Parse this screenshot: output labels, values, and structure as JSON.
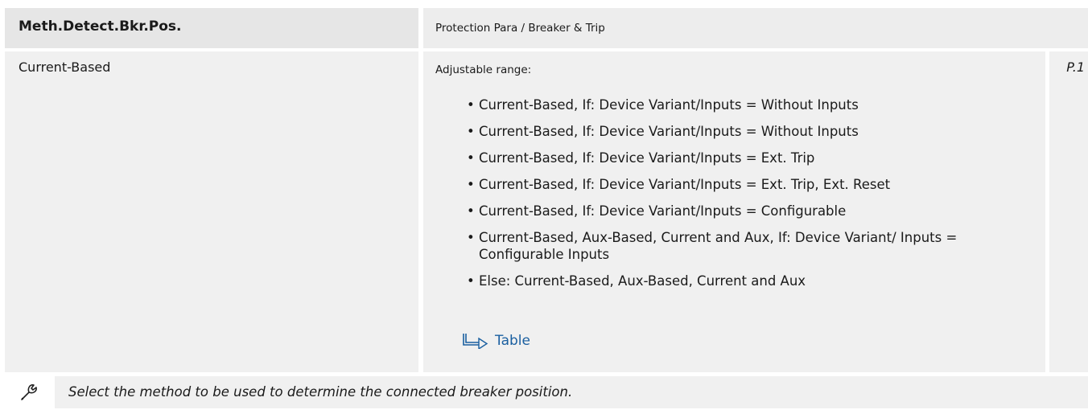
{
  "header": {
    "param_name": "Meth.Detect.Bkr.Pos.",
    "menu_path": "Protection Para / Breaker & Trip"
  },
  "value": {
    "default": "Current-Based"
  },
  "range": {
    "label": "Adjustable range:",
    "items": [
      "Current-Based, If: Device Variant/Inputs = Without Inputs",
      "Current-Based, If: Device Variant/Inputs = Without Inputs",
      "Current-Based, If: Device Variant/Inputs = Ext. Trip",
      "Current-Based, If: Device Variant/Inputs = Ext. Trip, Ext. Reset",
      "Current-Based, If: Device Variant/Inputs = Configurable",
      "Current-Based, Aux-Based, Current and Aux, If: Device Variant/ Inputs = Configurable Inputs",
      "Else:  Current-Based, Aux-Based, Current and Aux"
    ],
    "link_label": "Table"
  },
  "param_set": "P.1",
  "description": "Select the method to be used to determine the connected breaker position.",
  "icons": {
    "link": "table-link-arrow-icon",
    "footer": "wrench-icon"
  },
  "colors": {
    "link": "#1a5fa0",
    "header_bg": "#e6e6e6",
    "cell_bg": "#f0f0f0"
  }
}
